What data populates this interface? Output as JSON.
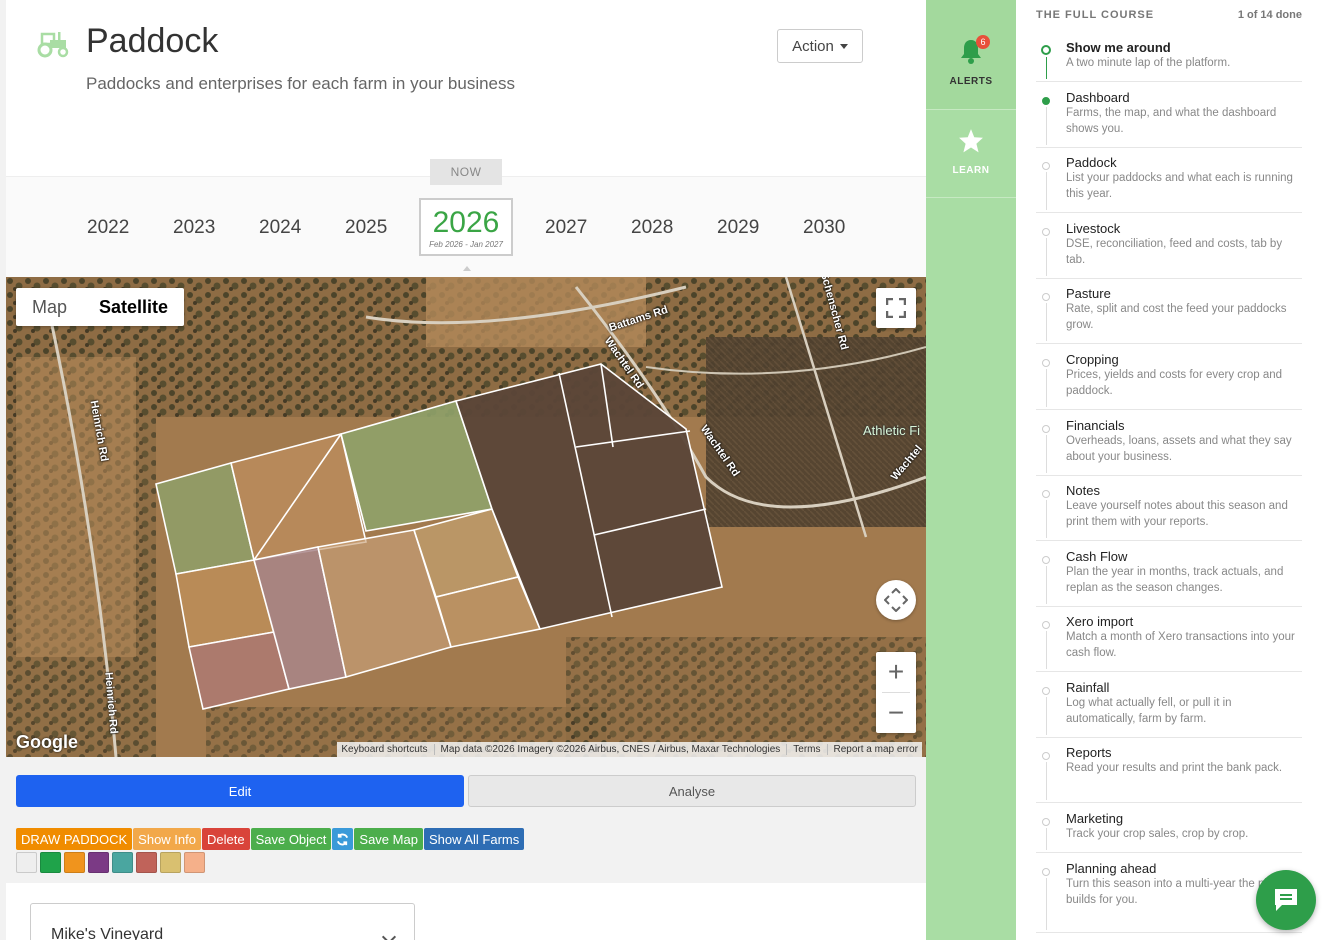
{
  "header": {
    "title": "Paddock",
    "subtitle": "Paddocks and enterprises for each farm in your business",
    "action_label": "Action"
  },
  "years": {
    "now_label": "NOW",
    "list": [
      "2022",
      "2023",
      "2024",
      "2025",
      "2027",
      "2028",
      "2029",
      "2030"
    ],
    "current": "2026",
    "current_range": "Feb 2026 - Jan 2027"
  },
  "map": {
    "type_map": "Map",
    "type_satellite": "Satellite",
    "google": "Google",
    "attribution": [
      "Keyboard shortcuts",
      "Map data ©2026 Imagery ©2026 Airbus, CNES / Airbus, Maxar Technologies",
      "Terms",
      "Report a map error"
    ],
    "roads": [
      "Battams Rd",
      "Wachtel Rd",
      "Schenscher Rd",
      "Heinrich Rd",
      "Heinrich Rd",
      "Wachtel Rd",
      "Wachtel"
    ],
    "poi": "Athletic Fi"
  },
  "tabs": {
    "edit": "Edit",
    "analyse": "Analyse"
  },
  "toolbar": {
    "draw": "DRAW PADDOCK",
    "show_info": "Show Info",
    "delete": "Delete",
    "save_object": "Save Object",
    "save_map": "Save Map",
    "show_all": "Show All Farms"
  },
  "swatches": [
    "#eeeeee",
    "#1fa34a",
    "#f0941d",
    "#7b3a85",
    "#4aa6a0",
    "#c0635a",
    "#d9c070",
    "#f5b08a"
  ],
  "farm_select": {
    "value": "Mike's Vineyard"
  },
  "rail": {
    "alerts": "ALERTS",
    "alerts_count": "6",
    "learn": "LEARN"
  },
  "course": {
    "title": "THE FULL COURSE",
    "progress": "1 of 14 done",
    "steps": [
      {
        "title": "Show me around",
        "desc": "A two minute lap of the platform."
      },
      {
        "title": "Dashboard",
        "desc": "Farms, the map, and what the dashboard shows you."
      },
      {
        "title": "Paddock",
        "desc": "List your paddocks and what each is running this year."
      },
      {
        "title": "Livestock",
        "desc": "DSE, reconciliation, feed and costs, tab by tab."
      },
      {
        "title": "Pasture",
        "desc": "Rate, split and cost the feed your paddocks grow."
      },
      {
        "title": "Cropping",
        "desc": "Prices, yields and costs for every crop and paddock."
      },
      {
        "title": "Financials",
        "desc": "Overheads, loans, assets and what they say about your business."
      },
      {
        "title": "Notes",
        "desc": "Leave yourself notes about this season and print them with your reports."
      },
      {
        "title": "Cash Flow",
        "desc": "Plan the year in months, track actuals, and replan as the season changes."
      },
      {
        "title": "Xero import",
        "desc": "Match a month of Xero transactions into your cash flow."
      },
      {
        "title": "Rainfall",
        "desc": "Log what actually fell, or pull it in automatically, farm by farm."
      },
      {
        "title": "Reports",
        "desc": "Read your results and print the bank pack."
      },
      {
        "title": "Marketing",
        "desc": "Track your crop sales, crop by crop."
      },
      {
        "title": "Planning ahead",
        "desc": "Turn this season into a multi-year the platform builds for you."
      }
    ]
  },
  "colors": {
    "accent_green": "#3aa545",
    "edit_blue": "#1e62f0",
    "rail_green": "#a9dda4"
  }
}
